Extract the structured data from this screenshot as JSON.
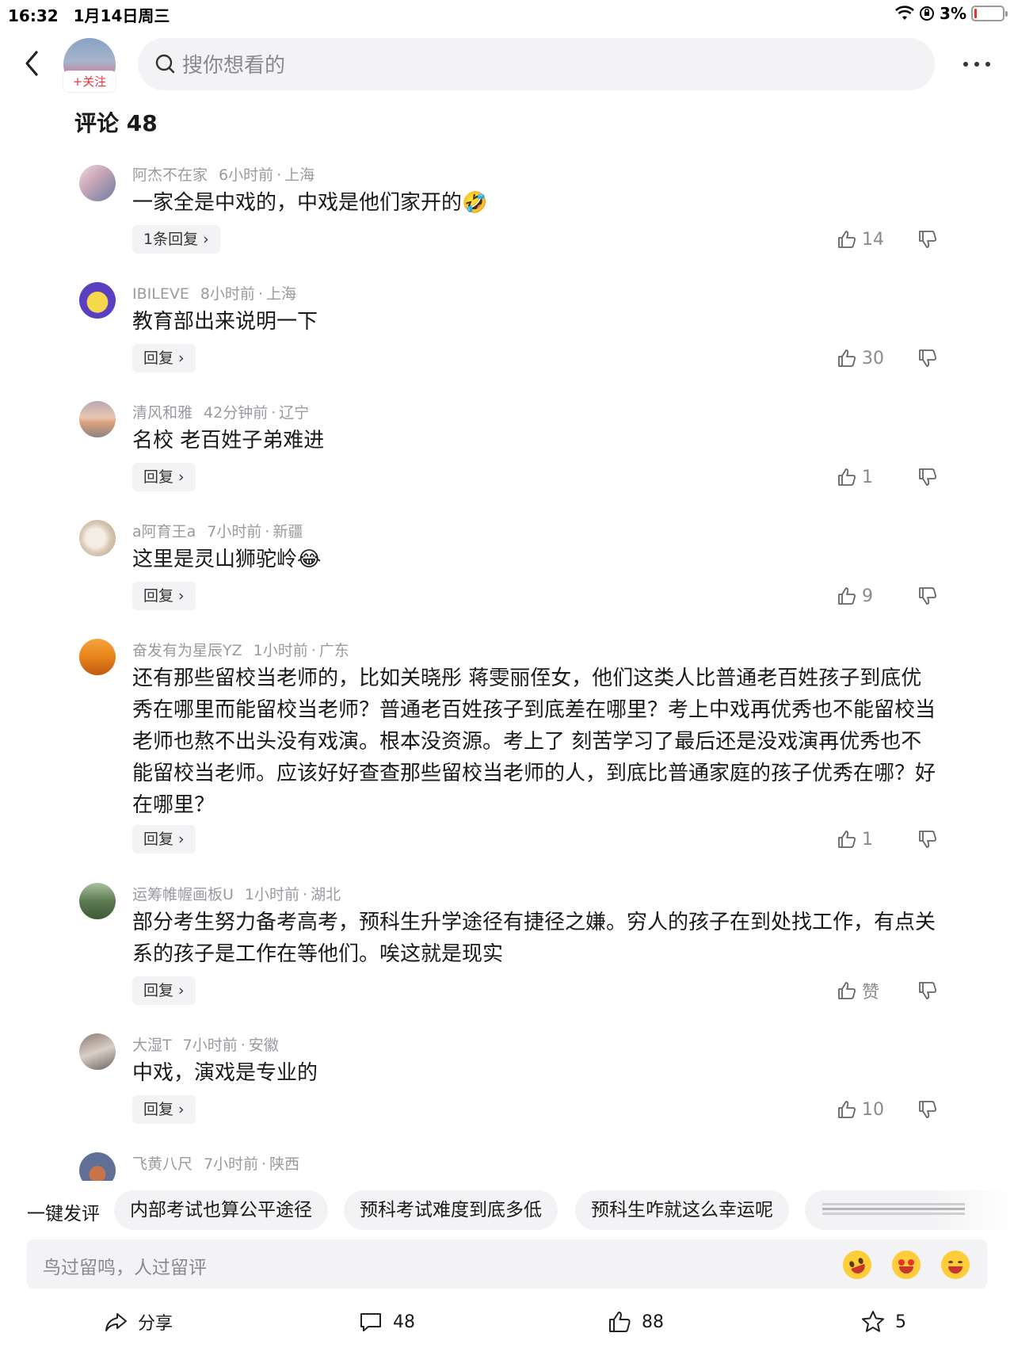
{
  "status_bar": {
    "time": "16:32",
    "date": "1月14日周三",
    "battery": "3%"
  },
  "header": {
    "follow_label": "+关注",
    "search_placeholder": "搜你想看的"
  },
  "comments_title": "评论 48",
  "comments": [
    {
      "user": "阿杰不在家",
      "time": "6小时前",
      "location": "上海",
      "text": "一家全是中戏的，中戏是他们家开的🤣",
      "reply_label": "1条回复 ›",
      "likes": "14"
    },
    {
      "user": "IBILEVE",
      "time": "8小时前",
      "location": "上海",
      "text": "教育部出来说明一下",
      "reply_label": "回复 ›",
      "likes": "30"
    },
    {
      "user": "清风和雅",
      "time": "42分钟前",
      "location": "辽宁",
      "text": "名校 老百姓子弟难进",
      "reply_label": "回复 ›",
      "likes": "1"
    },
    {
      "user": "a阿育王a",
      "time": "7小时前",
      "location": "新疆",
      "text": "这里是灵山狮驼岭😂",
      "reply_label": "回复 ›",
      "likes": "9"
    },
    {
      "user": "奋发有为星辰YZ",
      "time": "1小时前",
      "location": "广东",
      "text": "还有那些留校当老师的，比如关晓彤 蒋雯丽侄女，他们这类人比普通老百姓孩子到底优秀在哪里而能留校当老师？普通老百姓孩子到底差在哪里？考上中戏再优秀也不能留校当老师也熬不出头没有戏演。根本没资源。考上了 刻苦学习了最后还是没戏演再优秀也不能留校当老师。应该好好查查那些留校当老师的人，到底比普通家庭的孩子优秀在哪？好在哪里？",
      "reply_label": "回复 ›",
      "likes": "1"
    },
    {
      "user": "运筹帷幄画板U",
      "time": "1小时前",
      "location": "湖北",
      "text": "部分考生努力备考高考，预科生升学途径有捷径之嫌。穷人的孩子在到处找工作，有点关系的孩子是工作在等他们。唉这就是现实",
      "reply_label": "回复 ›",
      "likes": "赞"
    },
    {
      "user": "大湿T",
      "time": "7小时前",
      "location": "安徽",
      "text": "中戏，演戏是专业的",
      "reply_label": "回复 ›",
      "likes": "10"
    },
    {
      "user": "飞黄八尺",
      "time": "7小时前",
      "location": "陕西",
      "text": "",
      "reply_label": "",
      "likes": ""
    }
  ],
  "suggestions": {
    "label": "一键发评",
    "chips": [
      "内部考试也算公平途径",
      "预科考试难度到底多低",
      "预科生咋就这么幸运呢"
    ]
  },
  "input": {
    "placeholder": "鸟过留鸣，人过留评"
  },
  "actions": {
    "share": "分享",
    "comments": "48",
    "likes": "88",
    "favorites": "5"
  },
  "colors": {
    "accent_red": "#f0323c",
    "meta_gray": "#9a9aa0",
    "chip_bg": "#f3f3f5"
  }
}
